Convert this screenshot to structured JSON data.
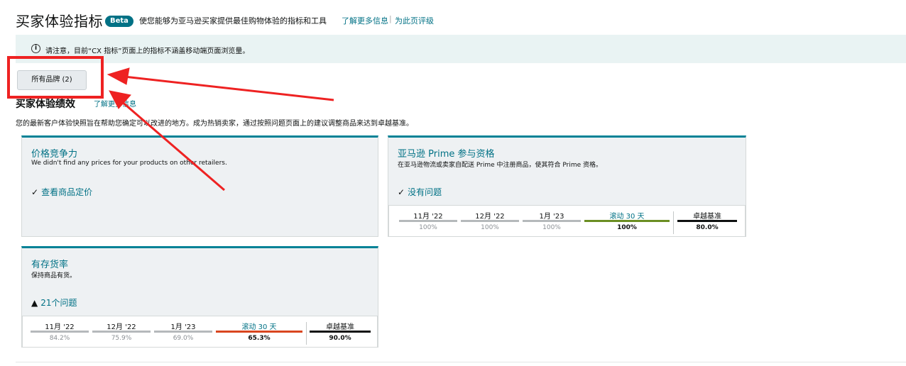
{
  "header": {
    "title": "买家体验指标",
    "badge": "Beta",
    "description": "使您能够为亚马逊买家提供最佳购物体验的指标和工具",
    "learn_more": "了解更多信息",
    "separator": "|",
    "rate_page": "为此页评级"
  },
  "alert": {
    "icon": "info-icon",
    "text": "请注意，目前“CX 指标”页面上的指标不涵盖移动端页面浏览量。"
  },
  "brand_button": "所有品牌 (2)",
  "section": {
    "title": "买家体验绩效",
    "learn_more": "了解更多信息",
    "description": "您的最新客户体验快照旨在帮助您确定可以改进的地方。成为热销卖家，通过按照问题页面上的建议调整商品来达到卓越基准。"
  },
  "cards": {
    "price": {
      "title": "价格竞争力",
      "subtitle": "We didn't find any prices for your products on other retailers.",
      "status_icon": "check-icon",
      "status_mark": "✓",
      "status": "查看商品定价"
    },
    "prime": {
      "title": "亚马逊 Prime 参与资格",
      "subtitle": "在亚马逊物流或卖家自配送 Prime 中注册商品，使其符合 Prime 资格。",
      "status_icon": "check-icon",
      "status_mark": "✓",
      "status": "没有问题",
      "columns": [
        "11月 '22",
        "12月 '22",
        "1月 '23",
        "滚动 30 天",
        "卓越基准"
      ],
      "values": [
        "100%",
        "100%",
        "100%",
        "100%",
        "80.0%"
      ],
      "bar_colors": [
        "#b5b9bb",
        "#b5b9bb",
        "#b5b9bb",
        "#6b8e23",
        "#0f1111"
      ]
    },
    "instock": {
      "title": "有存货率",
      "subtitle": "保持商品有货。",
      "status_icon": "warning-icon",
      "status_mark": "▲",
      "status": "21个问题",
      "columns": [
        "11月 '22",
        "12月 '22",
        "1月 '23",
        "滚动 30 天",
        "卓越基准"
      ],
      "values": [
        "84.2%",
        "75.9%",
        "69.0%",
        "65.3%",
        "90.0%"
      ],
      "bar_colors": [
        "#b5b9bb",
        "#b5b9bb",
        "#b5b9bb",
        "#d9461f",
        "#0f1111"
      ]
    }
  },
  "annotation_color": "#ee2222"
}
